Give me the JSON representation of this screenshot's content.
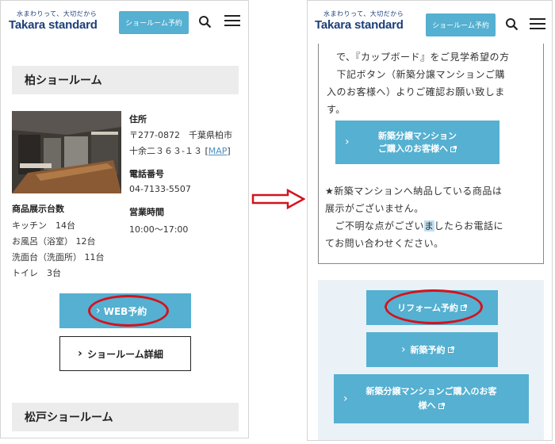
{
  "brand": {
    "tagline": "水まわりって、大切だから",
    "name": "Takara standard",
    "color": "#1c3f7a"
  },
  "header": {
    "showroom_reserve_label": "ショールーム予約",
    "search_icon": "search-icon",
    "menu_icon": "hamburger-menu-icon"
  },
  "left": {
    "section_title": "柏ショールーム",
    "address_label": "住所",
    "address_line1": "〒277-0872　千葉県柏市",
    "address_line2": "十余二３６３-１３ [",
    "map_link": "MAP",
    "address_close": "]",
    "phone_label": "電話番号",
    "phone": "04-7133-5507",
    "hours_label": "営業時間",
    "hours": "10:00～17:00",
    "products_label": "商品展示台数",
    "products": [
      "キッチン　14台",
      "お風呂（浴室）  12台",
      "洗面台（洗面所）  11台",
      "トイレ　3台"
    ],
    "web_reserve_label": "WEB予約",
    "detail_label": "ショールーム詳細",
    "next_section_title": "松戸ショールーム"
  },
  "right": {
    "lines": [
      "で、『カップボード』をご見学希望の方",
      "　下記ボタン（新築分譲マンションご購",
      "入のお客様へ）よりご確認お願い致しま",
      "す。"
    ],
    "condo_button_line1": "新築分譲マンション",
    "condo_button_line2": "ご購入のお客様へ",
    "notice_line1": "★新築マンションへ納品している商品は",
    "notice_line2": "展示がございません。",
    "notice_line3_a": "　ご不明な点がござい",
    "notice_line3_hl": "ま",
    "notice_line3_b": "したらお電話に",
    "notice_line4": "てお問い合わせください。",
    "reform_label": "リフォーム予約",
    "newbuild_label": "新築予約",
    "condo_reserve_line1": "新築分譲マンションご購入のお客",
    "condo_reserve_line2": "様へ"
  },
  "colors": {
    "accent": "#55b0d1",
    "highlight_circle": "#d3131e",
    "section_bg": "#ececec",
    "panel_bg": "#eaf2f8"
  }
}
